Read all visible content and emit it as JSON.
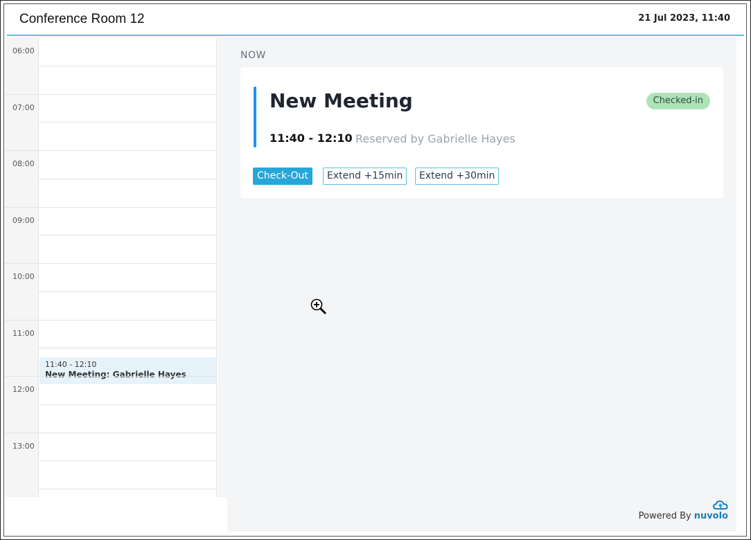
{
  "header": {
    "room_title": "Conference Room 12",
    "datetime": "21 Jul 2023, 11:40"
  },
  "timeline": {
    "hours": [
      "06:00",
      "07:00",
      "08:00",
      "09:00",
      "10:00",
      "11:00",
      "12:00",
      "13:00"
    ],
    "event": {
      "time": "11:40 - 12:10",
      "title": "New Meeting: Gabrielle Hayes"
    }
  },
  "main": {
    "now_label": "NOW",
    "meeting": {
      "title": "New Meeting",
      "time": "11:40 - 12:10",
      "reserved_by": "Reserved by Gabrielle Hayes",
      "status": "Checked-in"
    },
    "actions": {
      "checkout": "Check-Out",
      "extend15": "Extend +15min",
      "extend30": "Extend +30min"
    }
  },
  "footer": {
    "powered_by": "Powered By",
    "brand": "nuvolo"
  },
  "colors": {
    "accent": "#1e90ff",
    "header_line": "#5bc0de",
    "checkout_bg": "#27a6d8",
    "status_bg": "#aee3b8"
  },
  "icons": {
    "cursor": "zoom-in-cursor-icon",
    "brand": "nuvolo-cloud-icon"
  }
}
